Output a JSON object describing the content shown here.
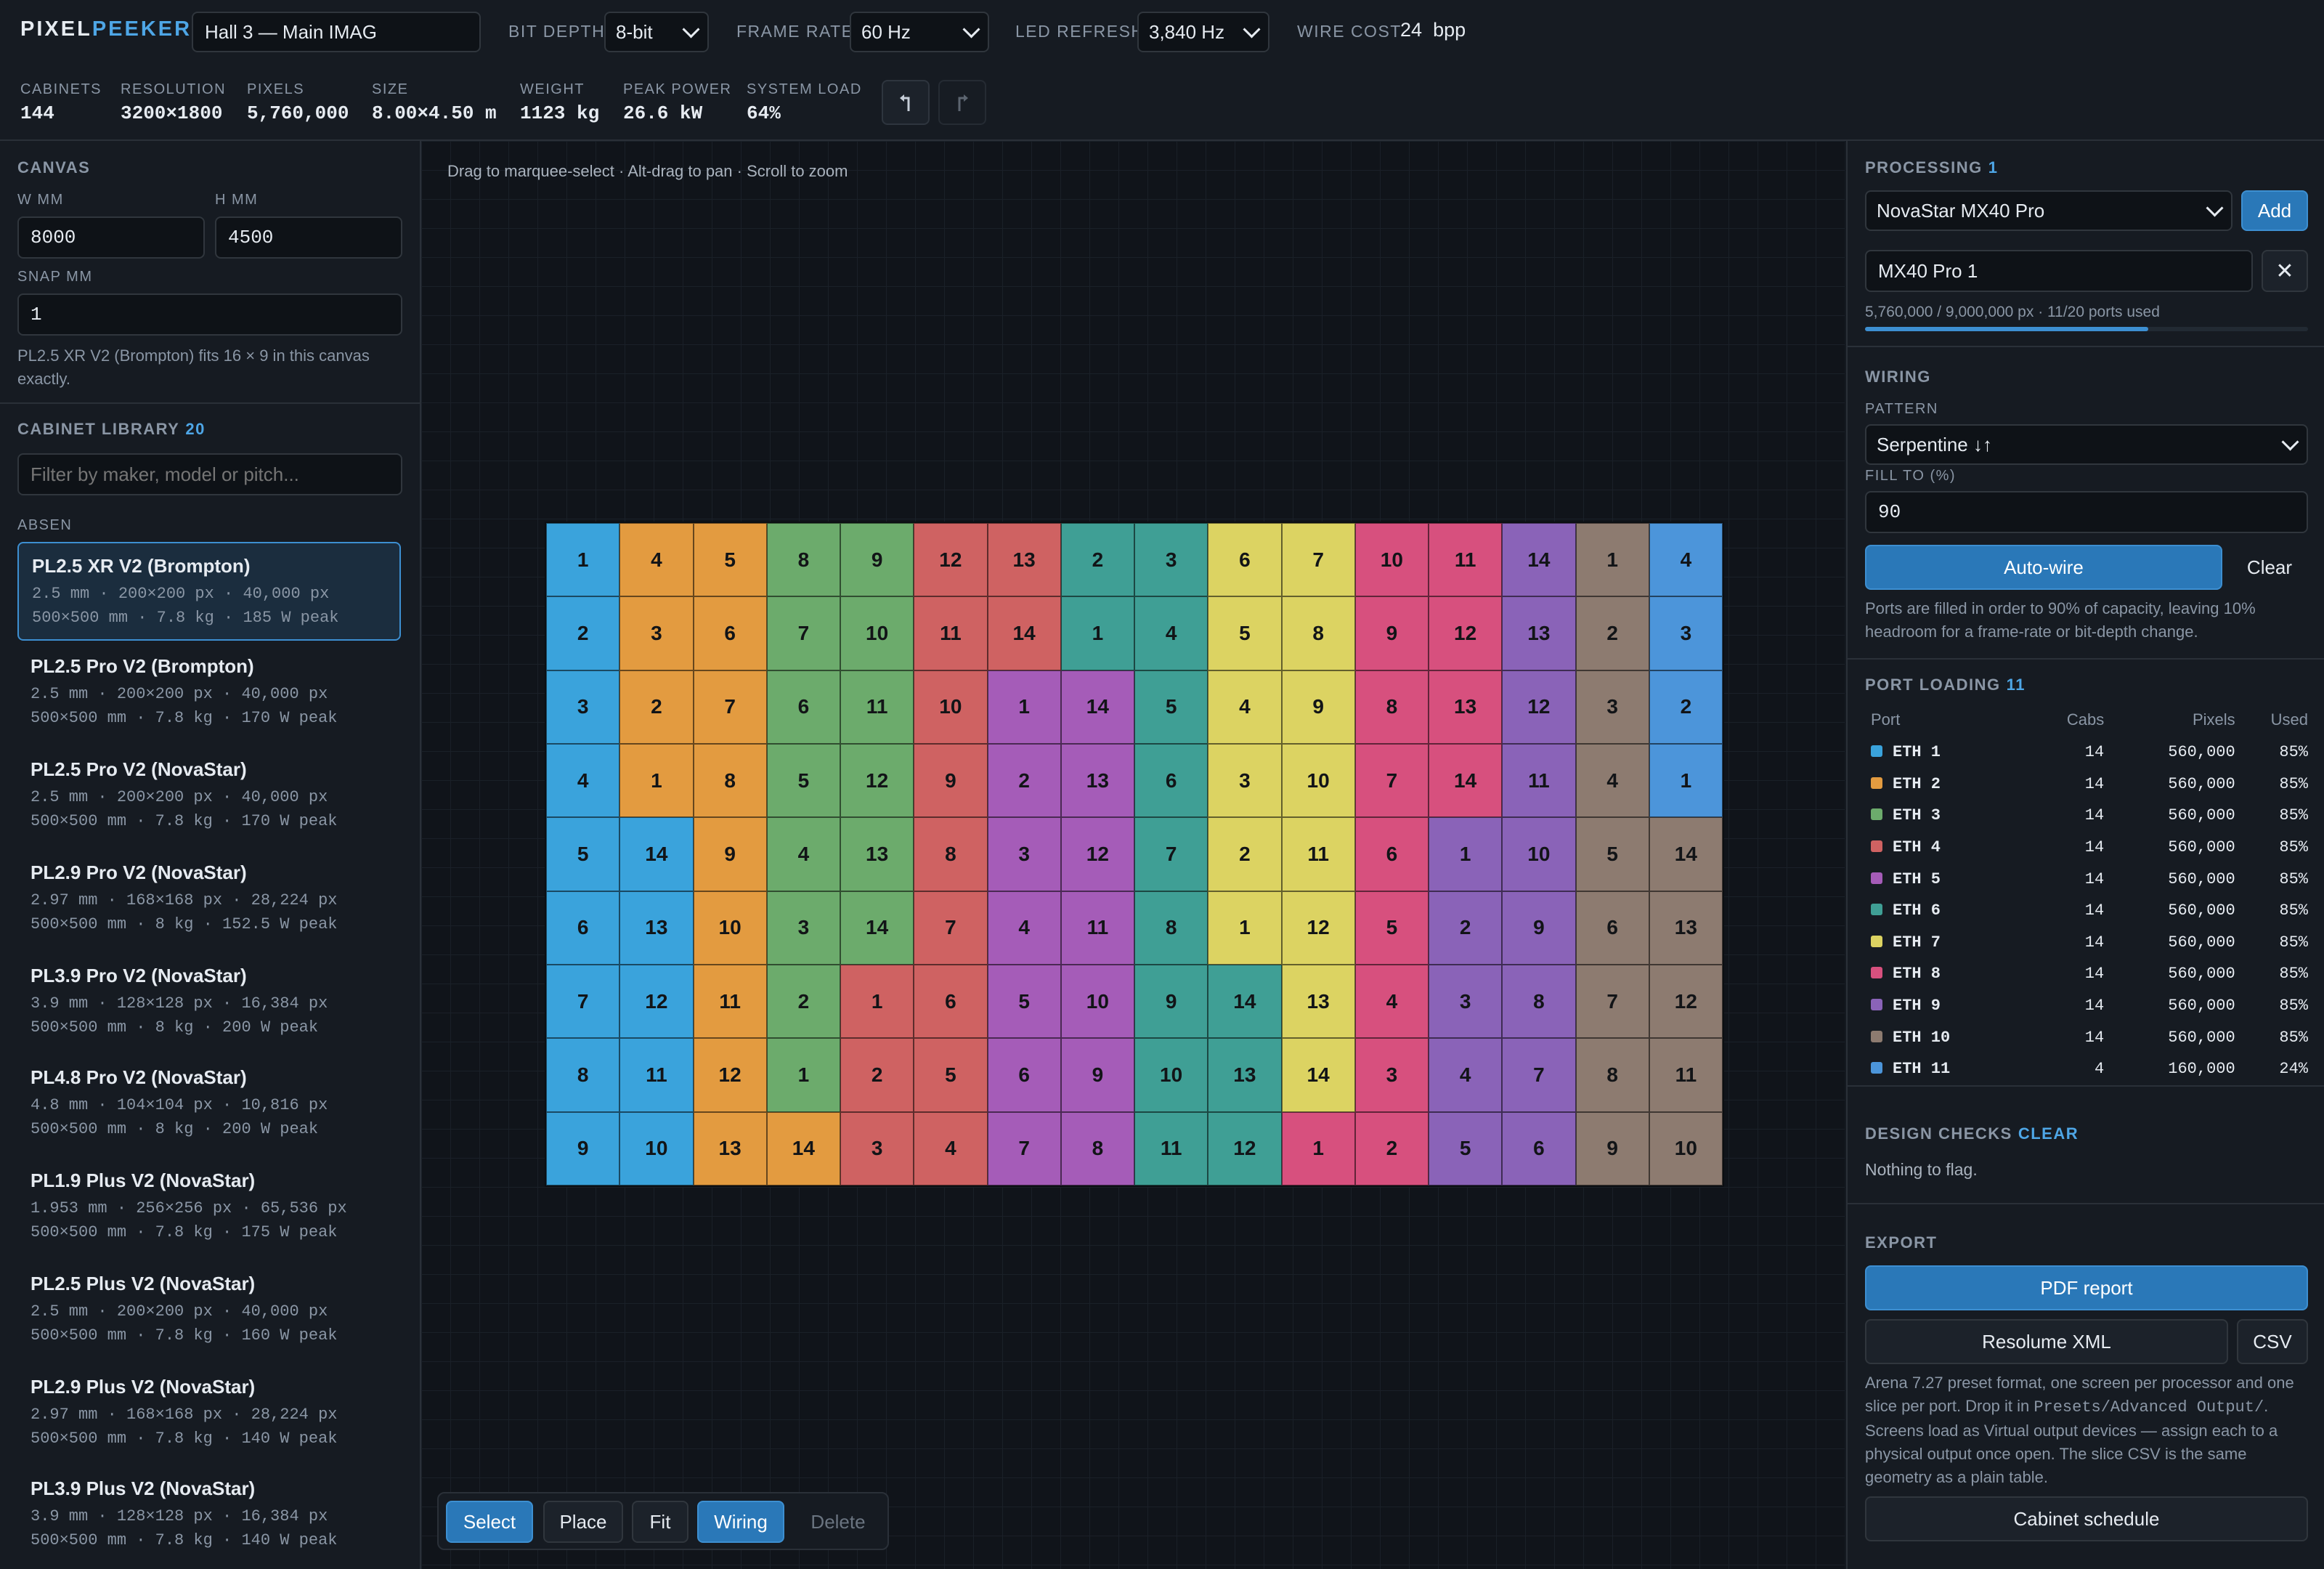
{
  "app": {
    "logo_a": "PIXEL",
    "logo_b": "PEEKER",
    "project_name": "Hall 3 — Main IMAG"
  },
  "top": {
    "bit_depth_label": "BIT DEPTH",
    "bit_depth": "8-bit",
    "frame_rate_label": "FRAME RATE",
    "frame_rate": "60 Hz",
    "led_refresh_label": "LED REFRESH",
    "led_refresh": "3,840 Hz",
    "wire_cost_label": "WIRE COST",
    "wire_cost": "24",
    "wire_cost_unit": "bpp"
  },
  "stats": [
    {
      "label": "CABINETS",
      "value": "144"
    },
    {
      "label": "RESOLUTION",
      "value": "3200×1800"
    },
    {
      "label": "PIXELS",
      "value": "5,760,000"
    },
    {
      "label": "SIZE",
      "value": "8.00×4.50 m"
    },
    {
      "label": "WEIGHT",
      "value": "1123 kg"
    },
    {
      "label": "PEAK POWER",
      "value": "26.6 kW"
    },
    {
      "label": "SYSTEM LOAD",
      "value": "64%"
    }
  ],
  "canvas": {
    "title": "CANVAS",
    "w_label": "W MM",
    "w": "8000",
    "h_label": "H MM",
    "h": "4500",
    "snap_label": "SNAP MM",
    "snap": "1",
    "fit_hint": "PL2.5 XR V2 (Brompton) fits 16 × 9 in this canvas exactly."
  },
  "library": {
    "title": "CABINET LIBRARY",
    "count": "20",
    "filter_placeholder": "Filter by maker, model or pitch...",
    "group": "ABSEN",
    "items": [
      {
        "name": "PL2.5 XR V2 (Brompton)",
        "spec1": "2.5 mm · 200×200 px · 40,000 px",
        "spec2": "500×500 mm · 7.8 kg · 185 W peak"
      },
      {
        "name": "PL2.5 Pro V2 (Brompton)",
        "spec1": "2.5 mm · 200×200 px · 40,000 px",
        "spec2": "500×500 mm · 7.8 kg · 170 W peak"
      },
      {
        "name": "PL2.5 Pro V2 (NovaStar)",
        "spec1": "2.5 mm · 200×200 px · 40,000 px",
        "spec2": "500×500 mm · 7.8 kg · 170 W peak"
      },
      {
        "name": "PL2.9 Pro V2 (NovaStar)",
        "spec1": "2.97 mm · 168×168 px · 28,224 px",
        "spec2": "500×500 mm · 8 kg · 152.5 W peak"
      },
      {
        "name": "PL3.9 Pro V2 (NovaStar)",
        "spec1": "3.9 mm · 128×128 px · 16,384 px",
        "spec2": "500×500 mm · 8 kg · 200 W peak"
      },
      {
        "name": "PL4.8 Pro V2 (NovaStar)",
        "spec1": "4.8 mm · 104×104 px · 10,816 px",
        "spec2": "500×500 mm · 8 kg · 200 W peak"
      },
      {
        "name": "PL1.9 Plus V2 (NovaStar)",
        "spec1": "1.953 mm · 256×256 px · 65,536 px",
        "spec2": "500×500 mm · 7.8 kg · 175 W peak"
      },
      {
        "name": "PL2.5 Plus V2 (NovaStar)",
        "spec1": "2.5 mm · 200×200 px · 40,000 px",
        "spec2": "500×500 mm · 7.8 kg · 160 W peak"
      },
      {
        "name": "PL2.9 Plus V2 (NovaStar)",
        "spec1": "2.97 mm · 168×168 px · 28,224 px",
        "spec2": "500×500 mm · 7.8 kg · 140 W peak"
      },
      {
        "name": "PL3.9 Plus V2 (NovaStar)",
        "spec1": "3.9 mm · 128×128 px · 16,384 px",
        "spec2": "500×500 mm · 7.8 kg · 140 W peak"
      }
    ]
  },
  "center": {
    "hint": "Drag to marquee-select · Alt-drag to pan · Scroll to zoom",
    "tools": {
      "select": "Select",
      "place": "Place",
      "fit": "Fit",
      "wiring": "Wiring",
      "delete": "Delete"
    }
  },
  "grid": {
    "cols": 16,
    "rows": 9,
    "port_colors": [
      "#3aa3dc",
      "#e39b40",
      "#6cab6c",
      "#cf6262",
      "#a55cb8",
      "#3f9f95",
      "#dcd362",
      "#d7507e",
      "#8a63b8",
      "#8d7b70",
      "#4c95da"
    ],
    "ports": [
      [
        0,
        1,
        1,
        2,
        2,
        3,
        3,
        5,
        5,
        6,
        6,
        7,
        7,
        8,
        9,
        10
      ],
      [
        0,
        1,
        1,
        2,
        2,
        3,
        3,
        5,
        5,
        6,
        6,
        7,
        7,
        8,
        9,
        10
      ],
      [
        0,
        1,
        1,
        2,
        2,
        3,
        4,
        4,
        5,
        6,
        6,
        7,
        7,
        8,
        9,
        10
      ],
      [
        0,
        1,
        1,
        2,
        2,
        3,
        4,
        4,
        5,
        6,
        6,
        7,
        7,
        8,
        9,
        10
      ],
      [
        0,
        0,
        1,
        2,
        2,
        3,
        4,
        4,
        5,
        6,
        6,
        7,
        8,
        8,
        9,
        9
      ],
      [
        0,
        0,
        1,
        2,
        2,
        3,
        4,
        4,
        5,
        6,
        6,
        7,
        8,
        8,
        9,
        9
      ],
      [
        0,
        0,
        1,
        2,
        3,
        3,
        4,
        4,
        5,
        5,
        6,
        7,
        8,
        8,
        9,
        9
      ],
      [
        0,
        0,
        1,
        2,
        3,
        3,
        4,
        4,
        5,
        5,
        6,
        7,
        8,
        8,
        9,
        9
      ],
      [
        0,
        0,
        1,
        1,
        3,
        3,
        4,
        4,
        5,
        5,
        7,
        7,
        8,
        8,
        9,
        9
      ]
    ],
    "labels": [
      [
        "1",
        "4",
        "5",
        "8",
        "9",
        "12",
        "13",
        "2",
        "3",
        "6",
        "7",
        "10",
        "11",
        "14",
        "1",
        "4"
      ],
      [
        "2",
        "3",
        "6",
        "7",
        "10",
        "11",
        "14",
        "1",
        "4",
        "5",
        "8",
        "9",
        "12",
        "13",
        "2",
        "3"
      ],
      [
        "3",
        "2",
        "7",
        "6",
        "11",
        "10",
        "1",
        "14",
        "5",
        "4",
        "9",
        "8",
        "13",
        "12",
        "3",
        "2"
      ],
      [
        "4",
        "1",
        "8",
        "5",
        "12",
        "9",
        "2",
        "13",
        "6",
        "3",
        "10",
        "7",
        "14",
        "11",
        "4",
        "1"
      ],
      [
        "5",
        "14",
        "9",
        "4",
        "13",
        "8",
        "3",
        "12",
        "7",
        "2",
        "11",
        "6",
        "1",
        "10",
        "5",
        "14"
      ],
      [
        "6",
        "13",
        "10",
        "3",
        "14",
        "7",
        "4",
        "11",
        "8",
        "1",
        "12",
        "5",
        "2",
        "9",
        "6",
        "13"
      ],
      [
        "7",
        "12",
        "11",
        "2",
        "1",
        "6",
        "5",
        "10",
        "9",
        "14",
        "13",
        "4",
        "3",
        "8",
        "7",
        "12"
      ],
      [
        "8",
        "11",
        "12",
        "1",
        "2",
        "5",
        "6",
        "9",
        "10",
        "13",
        "14",
        "3",
        "4",
        "7",
        "8",
        "11"
      ],
      [
        "9",
        "10",
        "13",
        "14",
        "3",
        "4",
        "7",
        "8",
        "11",
        "12",
        "1",
        "2",
        "5",
        "6",
        "9",
        "10"
      ]
    ]
  },
  "processing": {
    "title": "PROCESSING",
    "count": "1",
    "model": "NovaStar MX40 Pro",
    "add": "Add",
    "instance": "MX40 Pro 1",
    "usage": "5,760,000 / 9,000,000 px · 11/20 ports used",
    "usage_fraction": 0.64
  },
  "wiring": {
    "title": "WIRING",
    "pattern_label": "PATTERN",
    "pattern": "Serpentine ↓↑",
    "fill_label": "FILL TO (%)",
    "fill": "90",
    "autowire": "Auto-wire",
    "clear": "Clear",
    "note": "Ports are filled in order to 90% of capacity, leaving 10% headroom for a frame-rate or bit-depth change."
  },
  "port_loading": {
    "title": "PORT LOADING",
    "count": "11",
    "headers": [
      "Port",
      "Cabs",
      "Pixels",
      "Used"
    ],
    "rows": [
      {
        "port": "ETH 1",
        "cabs": "14",
        "pixels": "560,000",
        "used": "85%"
      },
      {
        "port": "ETH 2",
        "cabs": "14",
        "pixels": "560,000",
        "used": "85%"
      },
      {
        "port": "ETH 3",
        "cabs": "14",
        "pixels": "560,000",
        "used": "85%"
      },
      {
        "port": "ETH 4",
        "cabs": "14",
        "pixels": "560,000",
        "used": "85%"
      },
      {
        "port": "ETH 5",
        "cabs": "14",
        "pixels": "560,000",
        "used": "85%"
      },
      {
        "port": "ETH 6",
        "cabs": "14",
        "pixels": "560,000",
        "used": "85%"
      },
      {
        "port": "ETH 7",
        "cabs": "14",
        "pixels": "560,000",
        "used": "85%"
      },
      {
        "port": "ETH 8",
        "cabs": "14",
        "pixels": "560,000",
        "used": "85%"
      },
      {
        "port": "ETH 9",
        "cabs": "14",
        "pixels": "560,000",
        "used": "85%"
      },
      {
        "port": "ETH 10",
        "cabs": "14",
        "pixels": "560,000",
        "used": "85%"
      },
      {
        "port": "ETH 11",
        "cabs": "4",
        "pixels": "160,000",
        "used": "24%"
      }
    ]
  },
  "design_checks": {
    "title": "DESIGN CHECKS",
    "status": "CLEAR",
    "message": "Nothing to flag."
  },
  "export": {
    "title": "EXPORT",
    "pdf": "PDF report",
    "resolume": "Resolume XML",
    "csv": "CSV",
    "note_a": "Arena 7.27 preset format, one screen per processor and one slice per port. Drop it in ",
    "note_path": "Presets/Advanced Output/",
    "note_b": ". Screens load as Virtual output devices — assign each to a physical output once open. The slice CSV is the same geometry as a plain table.",
    "schedule": "Cabinet schedule"
  }
}
